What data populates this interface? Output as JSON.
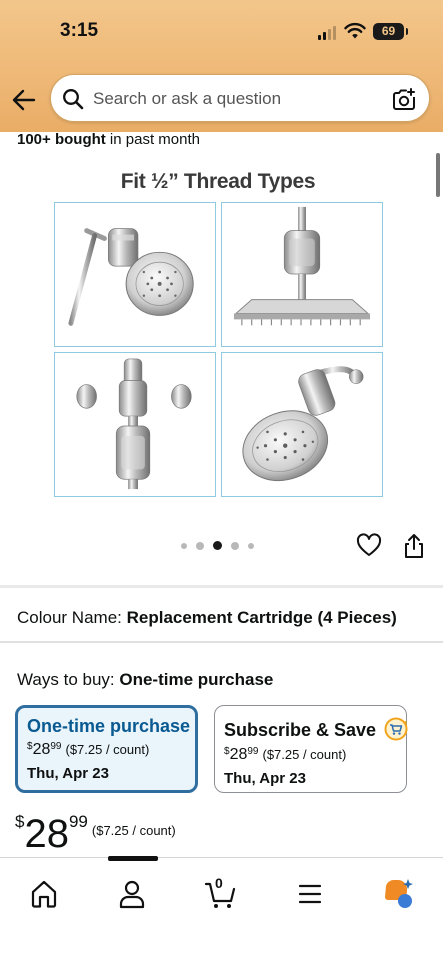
{
  "status_bar": {
    "time": "3:15",
    "battery": "69"
  },
  "search": {
    "placeholder": "Search or ask a question"
  },
  "product": {
    "bought_bold": "100+ bought",
    "bought_rest": " in past month",
    "image_title": "Fit ½” Thread Types",
    "carousel": {
      "count": 5,
      "active_index": 2
    }
  },
  "colour": {
    "label": "Colour Name:",
    "value": "Replacement Cartridge (4 Pieces)"
  },
  "ways_to_buy": {
    "label": "Ways to buy:",
    "value": "One-time purchase"
  },
  "options": [
    {
      "title": "One-time purchase",
      "dollar": "$",
      "whole": "28",
      "cents": "99",
      "unit": "($7.25 / count)",
      "date": "Thu, Apr 23",
      "selected": true
    },
    {
      "title": "Subscribe & Save",
      "dollar": "$",
      "whole": "28",
      "cents": "99",
      "unit": "($7.25 / count)",
      "date": "Thu, Apr 23",
      "selected": false
    }
  ],
  "price": {
    "dollar": "$",
    "whole": "28",
    "cents": "99",
    "unit": "($7.25 / count)"
  },
  "nav": {
    "items": [
      "home-icon",
      "account-icon",
      "cart-icon",
      "menu-icon",
      "rufus-icon"
    ],
    "cart_count": "0"
  },
  "colors": {
    "header": "#efb978",
    "selected_border": "#2f6e9e",
    "selected_bg": "#e9f4fb",
    "link_blue": "#0a5a92"
  }
}
